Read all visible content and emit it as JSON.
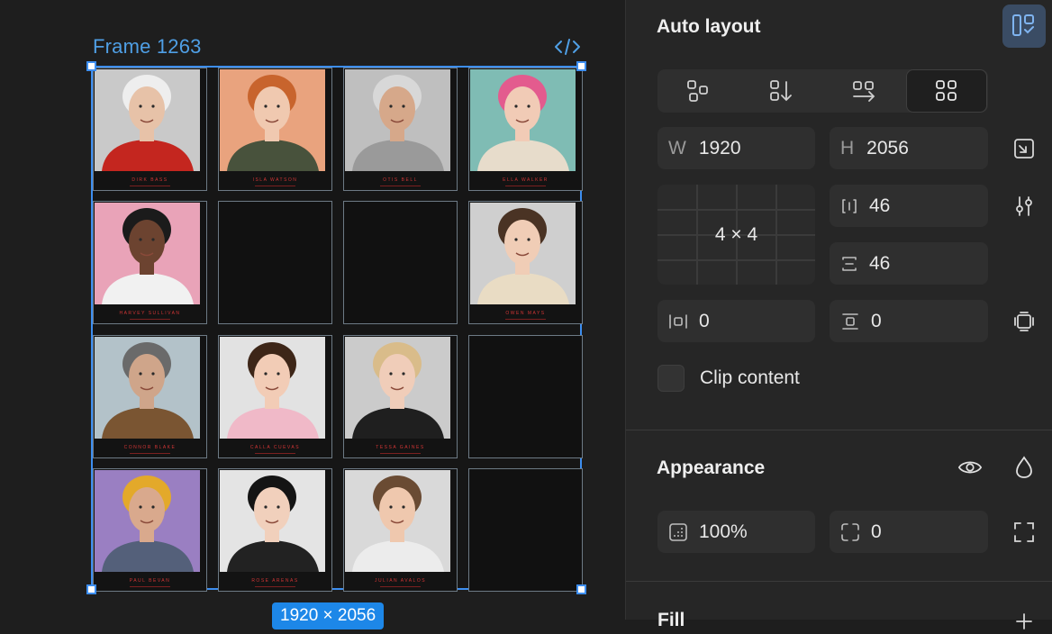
{
  "canvas": {
    "frame_name": "Frame 1263",
    "size_badge": "1920 × 2056",
    "cards": [
      {
        "name": "DIRK BASS",
        "person": "elderly-woman-red-jacket",
        "bg": "#c9c9c9",
        "skin": "#e7c2a8",
        "hair": "#eeeeee",
        "top": "#c4261f"
      },
      {
        "name": "ISLA WATSON",
        "person": "woman-red-hair-glasses",
        "bg": "#e9a37e",
        "skin": "#f0c9b0",
        "hair": "#c8642d",
        "top": "#48523c"
      },
      {
        "name": "OTIS BELL",
        "person": "man-gray-beard-glasses",
        "bg": "#bfbfbf",
        "skin": "#d6a88a",
        "hair": "#d8d8d8",
        "top": "#9a9a9a"
      },
      {
        "name": "ELLA WALKER",
        "person": "person-pink-hair",
        "bg": "#7fbcb4",
        "skin": "#f1cbb6",
        "hair": "#e35b8e",
        "top": "#e7dccb"
      },
      {
        "name": "HARVEY SULLIVAN",
        "person": "man-white-hoodie",
        "bg": "#e9a3b8",
        "skin": "#6c4330",
        "hair": "#1b1b1b",
        "top": "#f1f1f1"
      },
      {
        "name": "",
        "person": "",
        "bg": "",
        "skin": "",
        "hair": "",
        "top": ""
      },
      {
        "name": "",
        "person": "",
        "bg": "",
        "skin": "",
        "hair": "",
        "top": ""
      },
      {
        "name": "OWEN MAYS",
        "person": "young-man-curly-hair",
        "bg": "#cfcfcf",
        "skin": "#f0cdb6",
        "hair": "#4a3324",
        "top": "#e9dcc4"
      },
      {
        "name": "CONNOR BLAKE",
        "person": "man-beard-brown-shirt",
        "bg": "#b3c2c9",
        "skin": "#cfa58a",
        "hair": "#6a6a6a",
        "top": "#7a5532"
      },
      {
        "name": "CALLA CUEVAS",
        "person": "woman-curly-hair-pink",
        "bg": "#e2e2e2",
        "skin": "#f2ccb6",
        "hair": "#3d2618",
        "top": "#f0b9c8"
      },
      {
        "name": "TESSA GAINES",
        "person": "woman-blonde-black-shirt",
        "bg": "#cbcbcb",
        "skin": "#f0cdb9",
        "hair": "#d9bc8a",
        "top": "#1f1f1f"
      },
      {
        "name": "",
        "person": "",
        "bg": "",
        "skin": "",
        "hair": "",
        "top": ""
      },
      {
        "name": "PAUL BEVAN",
        "person": "older-man-yellow-beanie",
        "bg": "#9a7fc2",
        "skin": "#d9a98d",
        "hair": "#e3a92a",
        "top": "#54607a"
      },
      {
        "name": "ROSE ARENAS",
        "person": "woman-black-bob",
        "bg": "#e4e4e4",
        "skin": "#f1d0bc",
        "hair": "#141414",
        "top": "#222222"
      },
      {
        "name": "JULIAN AVALOS",
        "person": "man-glasses-white-shirt",
        "bg": "#d9d9d9",
        "skin": "#efc8ae",
        "hair": "#6a4b33",
        "top": "#ececec"
      },
      {
        "name": "",
        "person": "",
        "bg": "",
        "skin": "",
        "hair": "",
        "top": ""
      }
    ]
  },
  "panel": {
    "auto_layout": {
      "title": "Auto layout",
      "width_label": "W",
      "width_value": "1920",
      "height_label": "H",
      "height_value": "2056",
      "grid_label": "4 × 4",
      "col_gap": "46",
      "row_gap": "46",
      "padding_h": "0",
      "padding_v": "0",
      "clip_content": "Clip content"
    },
    "appearance": {
      "title": "Appearance",
      "opacity": "100%",
      "radius": "0"
    },
    "fill": {
      "title": "Fill"
    }
  },
  "colors": {
    "accent": "#3d8ef0",
    "badge": "#1d87e8",
    "caption_red": "#d03535"
  }
}
